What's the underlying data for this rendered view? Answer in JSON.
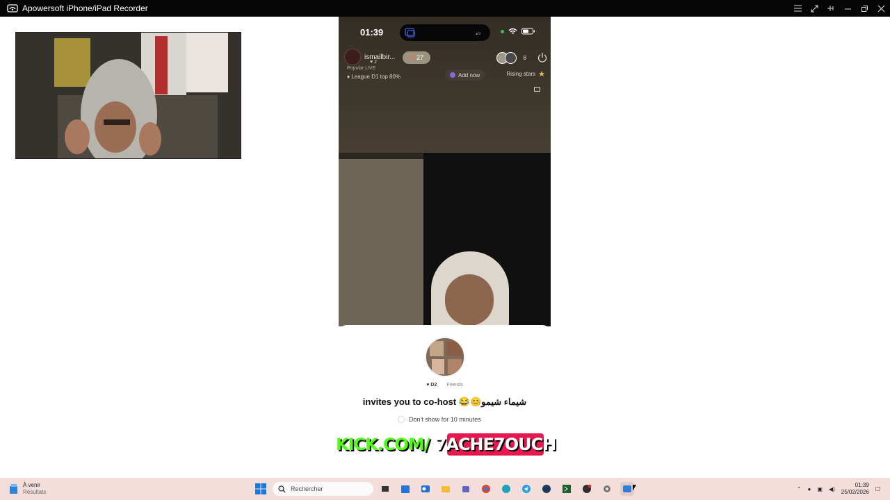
{
  "window": {
    "title": "Apowersoft iPhone/iPad Recorder"
  },
  "phone": {
    "time": "01:39",
    "host": {
      "name": "ismailbir...",
      "sub_count": "2",
      "likes": "27",
      "popular": "Popular LIVE",
      "league": "League D1 top 80%"
    },
    "viewers": "8",
    "add_now": "Add now",
    "rising_stars": "Rising stars"
  },
  "invite": {
    "level_badge": "D2",
    "relation": "Friends",
    "message": "شيماء شيمو😊😂 invites you to co-host",
    "dont_show": "Don't show for 10 minutes"
  },
  "banner": {
    "left": "KICK.COM/",
    "right": "7ACHE7OUCH"
  },
  "taskbar": {
    "weather_line1": "À venir",
    "weather_line2": "Résultats",
    "search_placeholder": "Rechercher",
    "time": "01:39",
    "date": "25/02/2026"
  },
  "colors": {
    "kick_green": "#53fc18",
    "kick_pink": "#e5194f",
    "taskbar": "#f3dedc"
  }
}
